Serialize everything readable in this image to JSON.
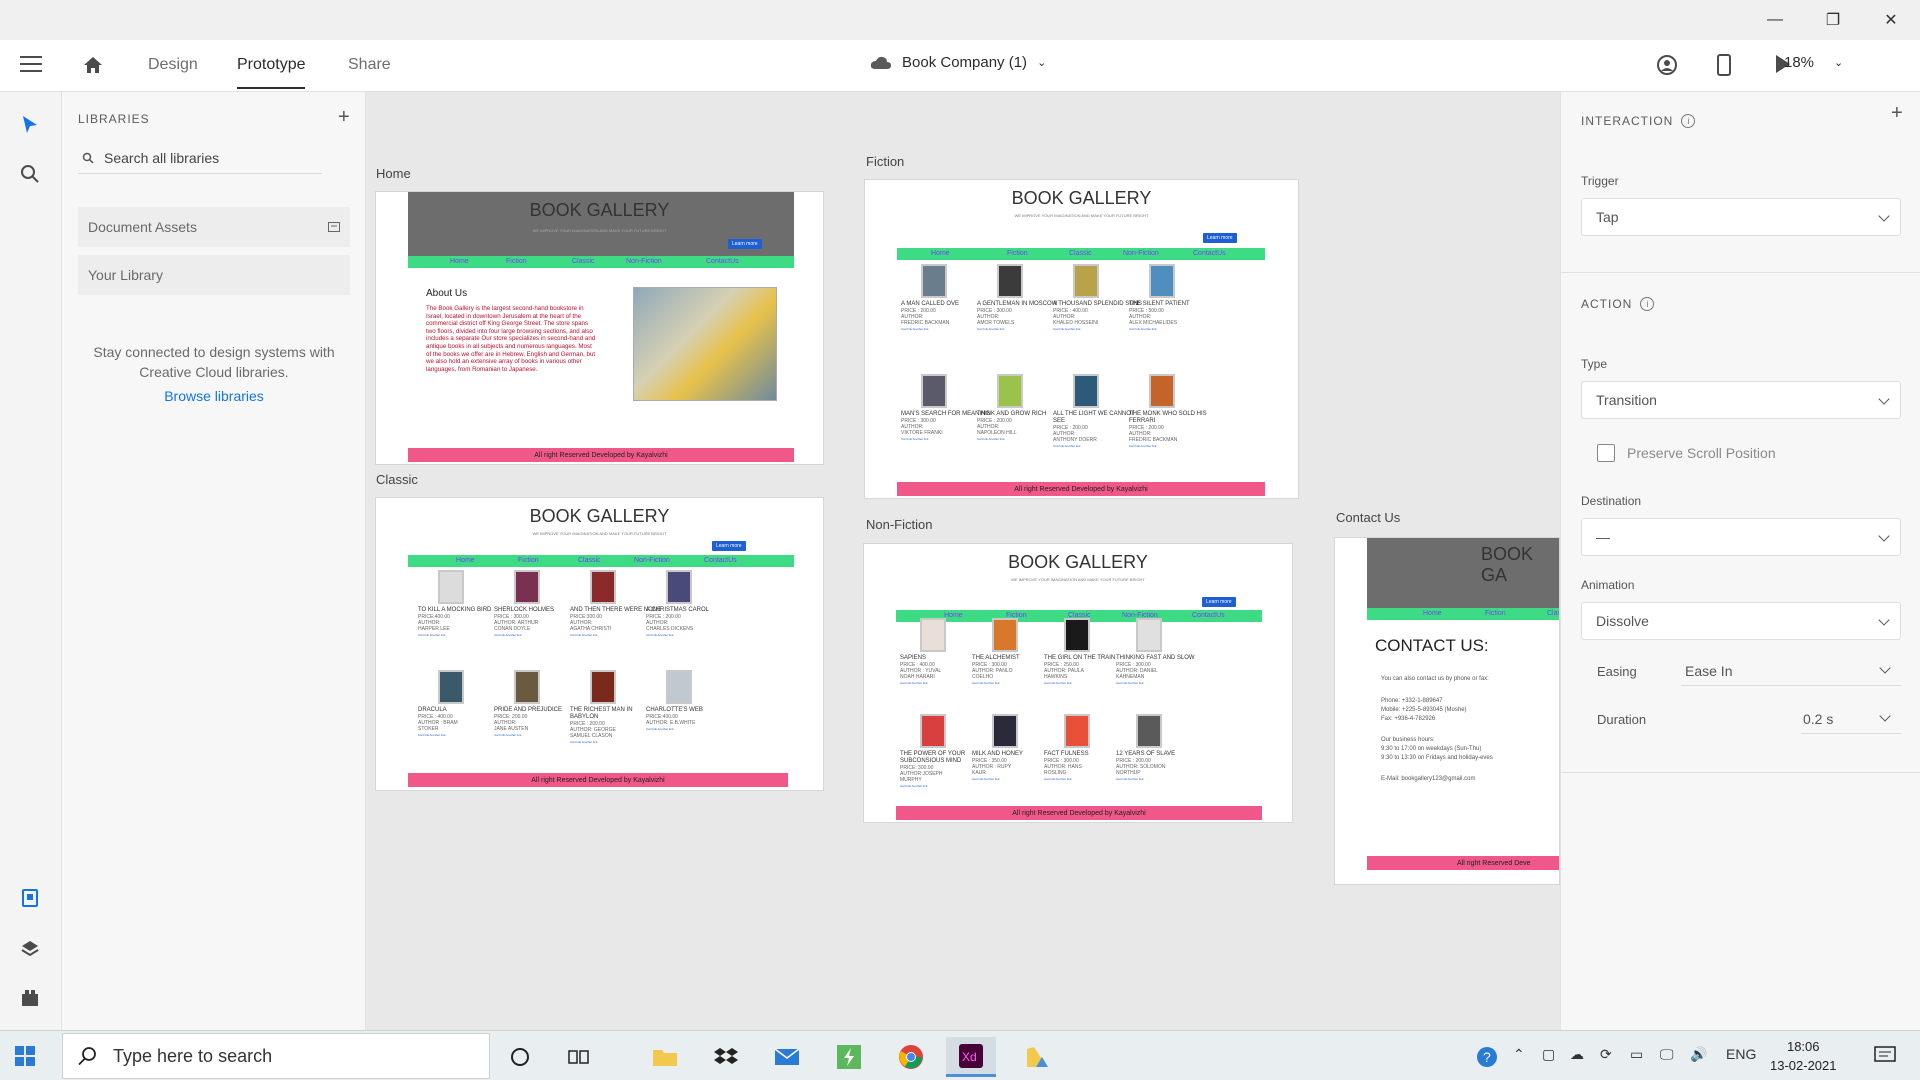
{
  "appbar": {
    "tabs": [
      "Design",
      "Prototype",
      "Share"
    ],
    "active_tab": "Prototype",
    "document_title": "Book Company (1)",
    "zoom": "18%"
  },
  "libraries": {
    "title": "LIBRARIES",
    "search_placeholder": "Search all libraries",
    "items": [
      "Document Assets",
      "Your Library"
    ],
    "message": "Stay connected to design systems with Creative Cloud libraries.",
    "link": "Browse libraries"
  },
  "site": {
    "title": "BOOK GALLERY",
    "tagline": "WE IMPROVE YOUR IMAGINATION AND MAKE YOUR FUTURE BRIGHT",
    "learn_more": "Learn more",
    "nav": [
      "Home",
      "Fiction",
      "Classic",
      "Non-Fiction",
      "ContactUs"
    ],
    "footer": "All right Reserved Developed by Kayalvizhi",
    "card_links": [
      "Cart link",
      "Another link"
    ]
  },
  "artboards": {
    "home": {
      "label": "Home",
      "about_title": "About Us",
      "about_text": "The Book Gallery is the largest second-hand bookstore in Israel, located in downtown Jerusalem at the heart of the commercial district off King George Street. The store spans two floors, divided into four large browsing sections, and also includes a separate Our store specializes in second-hand and antique books in all subjects and numerous languages. Most of the books we offer are in Hebrew, English and German, but we also hold an extensive array of books in various other languages, from Romanian to Japanese."
    },
    "fiction": {
      "label": "Fiction",
      "books": [
        {
          "name": "A MAN CALLED OVE",
          "price": "PRICE : 200.00",
          "author": "AUTHOR:",
          "author_name": "FREDRIC BACKMAN",
          "color": "#6a7d8c"
        },
        {
          "name": "A GENTLEMAN IN MOSCOW",
          "price": "PRICE : 300.00",
          "author": "AUTHOR:",
          "author_name": "AMOR TOWELS",
          "color": "#3b3b3b"
        },
        {
          "name": "A THOUSAND SPLENDID SUNS",
          "price": "PRICE : 400.00",
          "author": "AUTHOR:",
          "author_name": "KHALED HOSSEINI",
          "color": "#b8a24a"
        },
        {
          "name": "THE SILENT PATIENT",
          "price": "PRICE : 500.00",
          "author": "AUTHOR:",
          "author_name": "ALEX MICHAELIDES",
          "color": "#4f8fc0"
        },
        {
          "name": "MAN'S SEARCH FOR MEANING",
          "price": "PRICE : 300.00",
          "author": "AUTHOR:",
          "author_name": "VIKTORE FRANKI",
          "color": "#5a5a6a"
        },
        {
          "name": "THINK AND GROW RICH",
          "price": "PRICE : 200.00",
          "author": "AUTHOR:",
          "author_name": "NAPOLEON HILL",
          "color": "#9bc24a"
        },
        {
          "name": "ALL THE LIGHT WE CANNOT SEE",
          "price": "PRICE : 200.00",
          "author": "AUTHOR:",
          "author_name": "ANTHONY DOERR",
          "color": "#2e5a7a"
        },
        {
          "name": "THE MONK WHO SOLD HIS FERRARI",
          "price": "PRICE : 200.00",
          "author": "AUTHOR:",
          "author_name": "FREDRIC BACKMAN",
          "color": "#c4632a"
        }
      ]
    },
    "classic": {
      "label": "Classic",
      "books": [
        {
          "name": "TO KILL A MOCKING BIRD",
          "price": "PRICE:400.00",
          "author": "AUTHOR:",
          "author_name": "HARPER LEE",
          "color": "#dcdcdc"
        },
        {
          "name": "SHERLOCK HOLMES",
          "price": "PRICE : 300.00",
          "author": "AUTHOR: ARTHUR",
          "author_name": "CONAN DOYLE",
          "color": "#7a3050"
        },
        {
          "name": "AND THEN THERE WERE NONE",
          "price": "PRICE:300.00",
          "author": "AUTHOR:",
          "author_name": "AGATHA CHRISTI",
          "color": "#8a2a2a"
        },
        {
          "name": "A CHRISTMAS CAROL",
          "price": "PRICE : 200.00",
          "author": "AUTHOR:",
          "author_name": "CHARLES DICKENS",
          "color": "#4a4a7a"
        },
        {
          "name": "DRACULA",
          "price": "PRICE : 400.00",
          "author": "AUTHOR : BRAM",
          "author_name": "STOKER",
          "color": "#3a5a6a"
        },
        {
          "name": "PRIDE AND PREJUDICE",
          "price": "PRICE: 200.00",
          "author": "AUTHOR:",
          "author_name": "JANE AUSTEN",
          "color": "#6a5a40"
        },
        {
          "name": "THE RICHEST MAN IN BABYLON",
          "price": "PRICE : 200.00",
          "author": "AUTHOR: GEORGE",
          "author_name": "SAMUEL CLASON",
          "color": "#7a2a1a"
        },
        {
          "name": "CHARLOTTE'S WEB",
          "price": "PRICE:400.00",
          "author": "AUTHOR: E.B.WHITE",
          "author_name": "",
          "color": "#c0c8d0"
        }
      ]
    },
    "nonfiction": {
      "label": "Non-Fiction",
      "books": [
        {
          "name": "SAPIENS",
          "price": "PRICE : 400.00",
          "author": "AUTHOR : YUVAL",
          "author_name": "NOAH HARARI",
          "color": "#e8e0d8"
        },
        {
          "name": "THE ALCHEMIST",
          "price": "PRICE : 300.00",
          "author": "AUTHOR: PANLO",
          "author_name": "COELHO",
          "color": "#d8782a"
        },
        {
          "name": "THE GIRL ON THE TRAIN",
          "price": "PRICE : 250.00",
          "author": "AUTHOR: PAULA",
          "author_name": "HAWKINS",
          "color": "#1a1a1a"
        },
        {
          "name": "THINKING FAST AND SLOW",
          "price": "PRICE : 300.00",
          "author": "AUTHOR: DANIEL",
          "author_name": "KAHNEMAN",
          "color": "#e0e0e0"
        },
        {
          "name": "THE POWER OF YOUR SUBCONSIOUS MIND",
          "price": "PRICE: 300.00",
          "author": "AUTHOR:JOSEPH",
          "author_name": "MURPHY",
          "color": "#d84040"
        },
        {
          "name": "MILK AND HONEY",
          "price": "PRICE : 350.00",
          "author": "AUTHOR : RUPY",
          "author_name": "KAUR",
          "color": "#2a2a3a"
        },
        {
          "name": "FACT FULNESS",
          "price": "PRICE : 300.00",
          "author": "AUTHOR: HANS",
          "author_name": "ROSLING",
          "color": "#e8503a"
        },
        {
          "name": "12 YEARS OF SLAVE",
          "price": "PRICE : 200.00",
          "author": "AUTHOR: SOLOMON",
          "author_name": "NORTHUP",
          "color": "#5a5a5a"
        }
      ]
    },
    "contact": {
      "label": "Contact Us",
      "title_partial": "BOOK GA",
      "heading": "CONTACT US:",
      "lines": [
        "You can also contact us by phone or fax:",
        "Phone: +332-1-889647",
        "Mobile: +225-5-893045 (Moshe)",
        "Fax: +936-4-782926",
        "Our business hours:",
        "9:30 to 17:00 on weekdays (Sun-Thu)",
        "9:30 to 13:30 on Fridays and holiday-eves",
        "E-Mail:  bookgallery123@gmail.com"
      ],
      "footer_partial": "All right Reserved Deve"
    }
  },
  "inspector": {
    "interaction_title": "INTERACTION",
    "trigger_label": "Trigger",
    "trigger_value": "Tap",
    "action_title": "ACTION",
    "type_label": "Type",
    "type_value": "Transition",
    "preserve_scroll": "Preserve Scroll Position",
    "destination_label": "Destination",
    "destination_value": "—",
    "animation_label": "Animation",
    "animation_value": "Dissolve",
    "easing_label": "Easing",
    "easing_value": "Ease In",
    "duration_label": "Duration",
    "duration_value": "0.2 s"
  },
  "taskbar": {
    "search_placeholder": "Type here to search",
    "language": "ENG",
    "time": "18:06",
    "date": "13-02-2021"
  }
}
